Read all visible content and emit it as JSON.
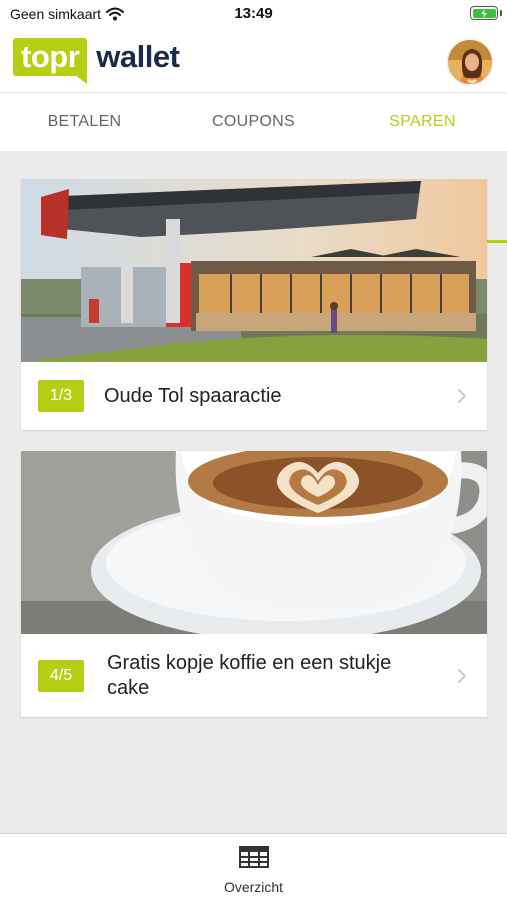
{
  "status_bar": {
    "carrier": "Geen simkaart",
    "time": "13:49"
  },
  "header": {
    "logo_badge": "topr",
    "logo_word": "wallet"
  },
  "tabs": [
    {
      "label": "BETALEN",
      "active": false
    },
    {
      "label": "COUPONS",
      "active": false
    },
    {
      "label": "SPAREN",
      "active": true
    }
  ],
  "cards": [
    {
      "progress": "1/3",
      "title": "Oude Tol spaaractie"
    },
    {
      "progress": "4/5",
      "title": "Gratis kopje koffie en een stukje cake"
    }
  ],
  "bottom_nav": {
    "label": "Overzicht"
  },
  "colors": {
    "accent": "#b6cf15",
    "brand_dark": "#1b2a4a",
    "background": "#ebebeb"
  }
}
